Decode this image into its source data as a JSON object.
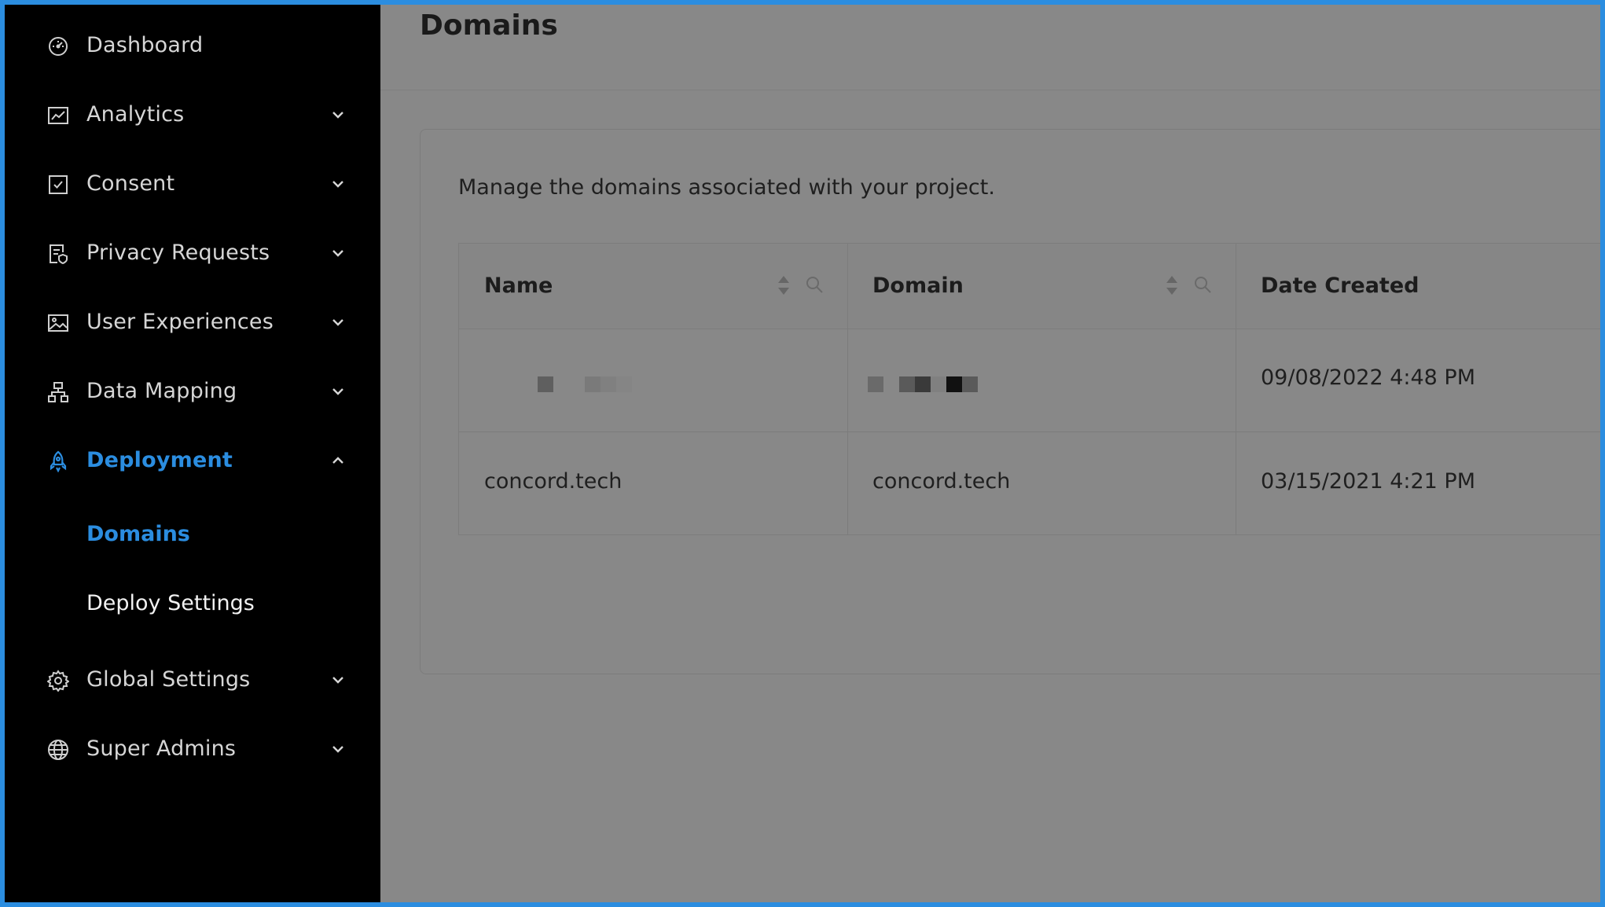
{
  "sidebar": {
    "items": [
      {
        "label": "Dashboard",
        "icon": "dashboard-icon",
        "expandable": false
      },
      {
        "label": "Analytics",
        "icon": "chart-line-icon",
        "expandable": true
      },
      {
        "label": "Consent",
        "icon": "checkbox-icon",
        "expandable": true
      },
      {
        "label": "Privacy Requests",
        "icon": "document-shield-icon",
        "expandable": true
      },
      {
        "label": "User Experiences",
        "icon": "image-icon",
        "expandable": true
      },
      {
        "label": "Data Mapping",
        "icon": "sitemap-icon",
        "expandable": true
      },
      {
        "label": "Deployment",
        "icon": "rocket-icon",
        "expandable": true,
        "expanded": true,
        "active": true
      },
      {
        "label": "Global Settings",
        "icon": "gear-icon",
        "expandable": true
      },
      {
        "label": "Super Admins",
        "icon": "globe-icon",
        "expandable": true
      }
    ],
    "deployment_subitems": [
      {
        "label": "Domains",
        "active": true
      },
      {
        "label": "Deploy Settings",
        "active": false
      }
    ]
  },
  "page": {
    "title": "Domains",
    "description": "Manage the domains associated with your project."
  },
  "table": {
    "columns": [
      {
        "label": "Name",
        "sortable": true,
        "filterable": true
      },
      {
        "label": "Domain",
        "sortable": true,
        "filterable": true
      },
      {
        "label": "Date Created",
        "sortable": false,
        "filterable": false
      }
    ],
    "rows": [
      {
        "name": "",
        "domain": "",
        "date_created": "09/08/2022 4:48 PM",
        "redacted": true
      },
      {
        "name": "concord.tech",
        "domain": "concord.tech",
        "date_created": "03/15/2021 4:21 PM",
        "redacted": false
      }
    ]
  },
  "colors": {
    "accent": "#2b8de0",
    "sidebar_bg": "#000000",
    "overlay_bg": "#888888"
  }
}
